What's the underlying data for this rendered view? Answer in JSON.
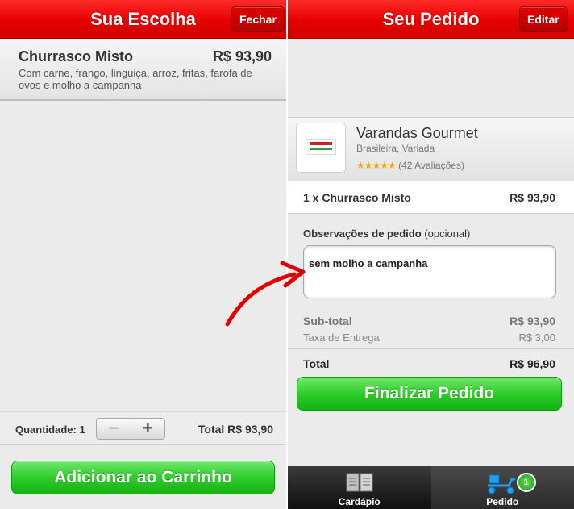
{
  "left": {
    "title": "Sua Escolha",
    "close_label": "Fechar",
    "item": {
      "name": "Churrasco Misto",
      "price": "R$ 93,90",
      "description": "Com carne, frango, linguiça, arroz,  fritas, farofa de ovos e molho a campanha"
    },
    "quantity_label": "Quantidade: 1",
    "quantity_value": 1,
    "stepper_minus": "−",
    "stepper_plus": "+",
    "total_label": "Total R$ 93,90",
    "add_button": "Adicionar ao Carrinho"
  },
  "right": {
    "title": "Seu Pedido",
    "edit_label": "Editar",
    "restaurant": {
      "name": "Varandas Gourmet",
      "categories": "Brasileira, Variada",
      "rating_stars": 4.5,
      "reviews": "(42 Avaliações)"
    },
    "order": {
      "line": "1 x Churrasco Misto",
      "price": "R$ 93,90"
    },
    "notes": {
      "label": "Observações de pedido",
      "optional": "(opcional)",
      "value": "sem molho a campanha"
    },
    "subtotal_label": "Sub-total",
    "subtotal_value": "R$ 93,90",
    "delivery_label": "Taxa de Entrega",
    "delivery_value": "R$ 3,00",
    "total_label": "Total",
    "total_value": "R$ 96,90",
    "finalize_button": "Finalizar Pedido",
    "tabs": [
      {
        "label": "Cardápio",
        "icon": "menu-book-icon",
        "active": false
      },
      {
        "label": "Pedido",
        "icon": "delivery-scooter-icon",
        "active": true,
        "badge": "1"
      }
    ]
  },
  "colors": {
    "navbar": "#e60000",
    "button_green": "#2ecc2a",
    "arrow": "#e00000"
  }
}
